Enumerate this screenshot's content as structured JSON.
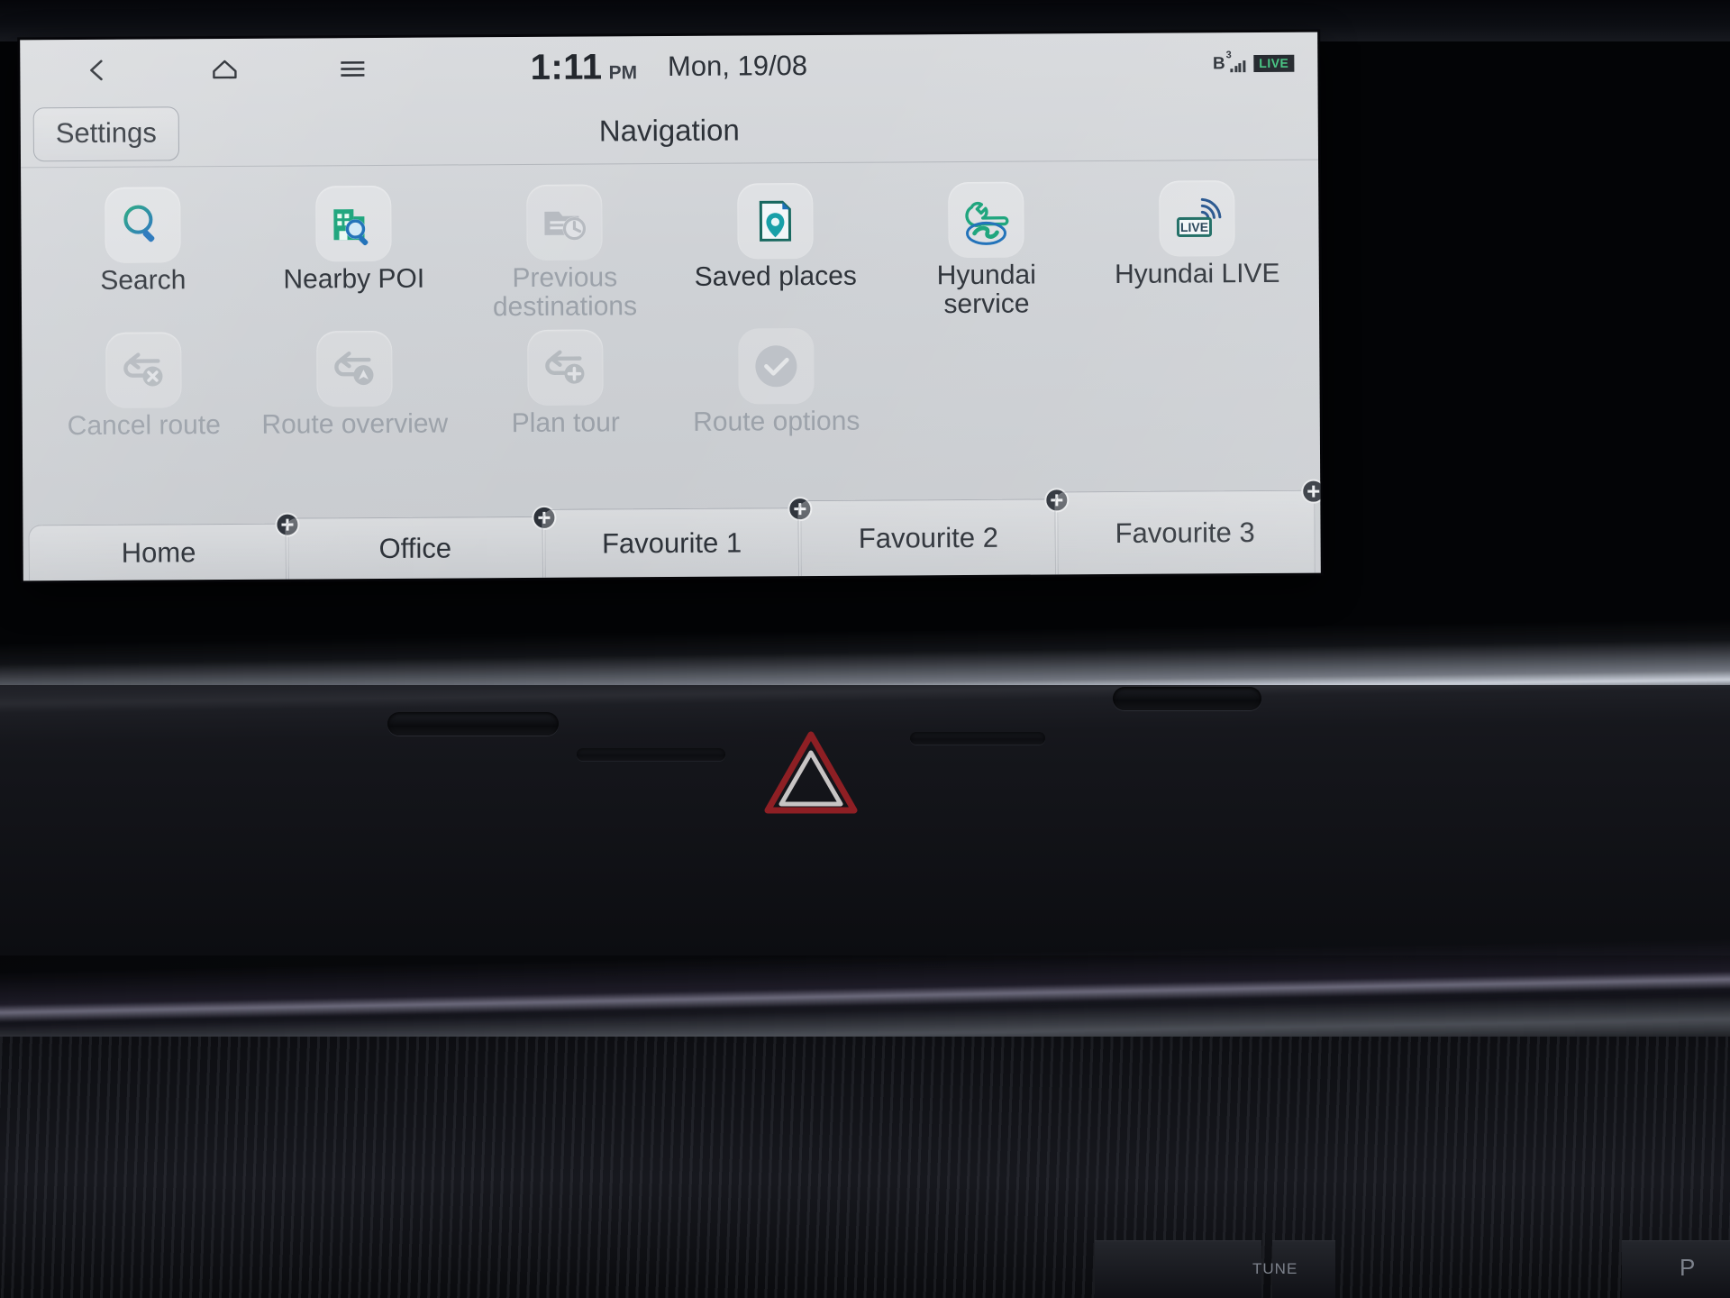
{
  "statusbar": {
    "back_icon": "chevron-left-icon",
    "home_icon": "home-icon",
    "menu_icon": "hamburger-menu-icon",
    "time": "1:11",
    "ampm": "PM",
    "date": "Mon, 19/08",
    "bluetooth_label": "B",
    "bluetooth_sup": "3",
    "live_badge": "LIVE"
  },
  "header": {
    "settings_label": "Settings",
    "title": "Navigation"
  },
  "menu": {
    "row1": [
      {
        "label": "Search",
        "icon": "search-magnifier-icon",
        "enabled": true
      },
      {
        "label": "Nearby POI",
        "icon": "building-search-icon",
        "enabled": true
      },
      {
        "label": "Previous\ndestinations",
        "icon": "document-clock-icon",
        "enabled": false
      },
      {
        "label": "Saved places",
        "icon": "page-pin-icon",
        "enabled": true
      },
      {
        "label": "Hyundai\nservice",
        "icon": "wrench-hyundai-logo-icon",
        "enabled": true
      },
      {
        "label": "Hyundai LIVE",
        "icon": "live-signal-icon",
        "enabled": true
      }
    ],
    "row2": [
      {
        "label": "Cancel route",
        "icon": "route-cancel-icon",
        "enabled": false
      },
      {
        "label": "Route overview",
        "icon": "route-overview-icon",
        "enabled": false
      },
      {
        "label": "Plan tour",
        "icon": "route-add-icon",
        "enabled": false
      },
      {
        "label": "Route options",
        "icon": "check-circle-icon",
        "enabled": false
      }
    ]
  },
  "favourites": [
    {
      "label": "Home",
      "add_icon": "plus-badge-icon"
    },
    {
      "label": "Office",
      "add_icon": "plus-badge-icon"
    },
    {
      "label": "Favourite 1",
      "add_icon": "plus-badge-icon"
    },
    {
      "label": "Favourite 2",
      "add_icon": "plus-badge-icon"
    },
    {
      "label": "Favourite 3",
      "add_icon": "plus-badge-icon"
    }
  ],
  "dashboard": {
    "hazard_icon": "hazard-warning-triangle-icon",
    "tune_label": "TUNE",
    "park_label": "P"
  },
  "colors": {
    "accent_green": "#19a37a",
    "accent_blue": "#1c6fb8",
    "screen_bg": "#cfd2d6",
    "text": "#2b3037",
    "disabled_text": "#9ba1a9",
    "hazard_red": "#b2262b"
  }
}
